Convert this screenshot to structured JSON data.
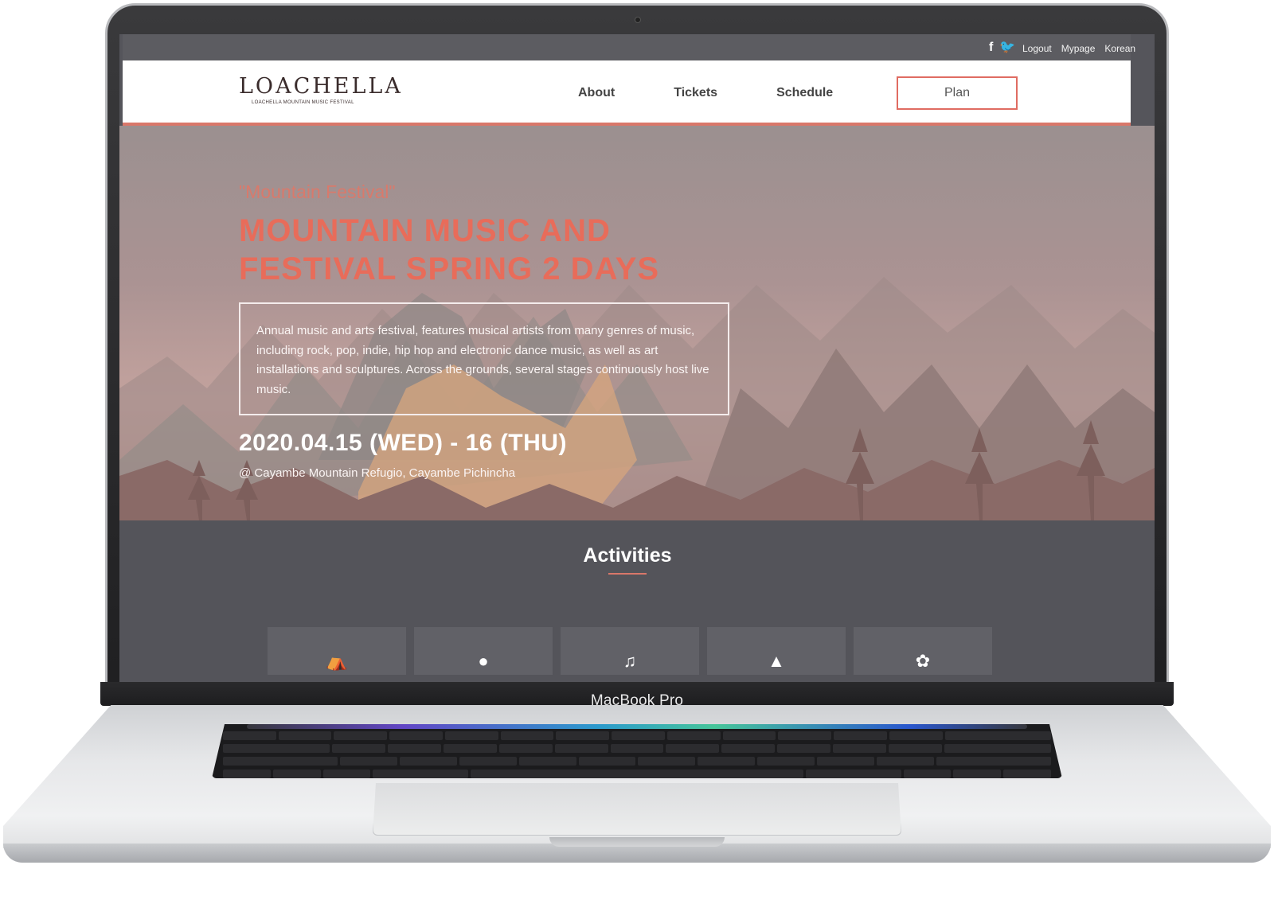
{
  "device": {
    "label": "MacBook Pro"
  },
  "topbar": {
    "social": [
      "f",
      "t"
    ],
    "links": [
      "Logout",
      "Mypage",
      "Korean"
    ]
  },
  "header": {
    "logo": {
      "title": "LOACHELLA",
      "subtitle": "LOACHELLA MOUNTAIN MUSIC FESTIVAL"
    },
    "nav": [
      "About",
      "Tickets",
      "Schedule"
    ],
    "plan_button": "Plan"
  },
  "hero": {
    "quote": "\"Mountain Festival\"",
    "title": "MOUNTAIN MUSIC AND FESTIVAL SPRING 2 DAYS",
    "description": "Annual music and arts festival, features musical artists from many genres of music, including rock, pop, indie, hip hop and electronic dance music, as well as art installations and sculptures. Across the grounds, several stages continuously host live music.",
    "date": "2020.04.15 (WED) - 16 (THU)",
    "venue": "@ Cayambe Mountain Refugio, Cayambe Pichincha"
  },
  "activities": {
    "title": "Activities",
    "cards": [
      {
        "icon": "tent-icon",
        "glyph": "⛺"
      },
      {
        "icon": "apple-icon",
        "glyph": ""
      },
      {
        "icon": "music-icon",
        "glyph": "♫"
      },
      {
        "icon": "android-icon",
        "glyph": "▲"
      },
      {
        "icon": "camera-icon",
        "glyph": "✿"
      }
    ]
  },
  "colors": {
    "accent": "#e86c5a",
    "nav_border": "#d9776a",
    "topbar": "#5c5c61",
    "activities_bg": "#54545a"
  }
}
